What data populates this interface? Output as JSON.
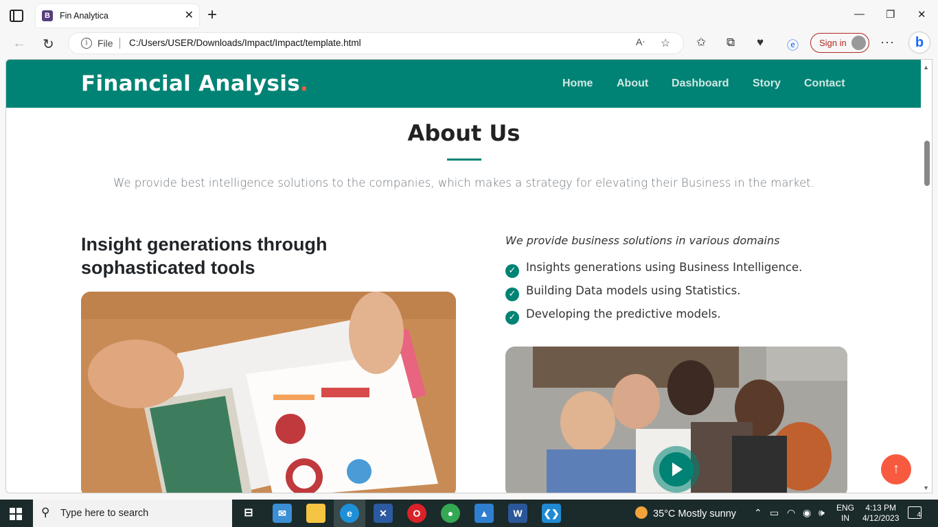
{
  "browser": {
    "tab_title": "Fin Analytica",
    "tab_favicon": "B",
    "address_prefix": "File",
    "url": "C:/Users/USER/Downloads/Impact/Impact/template.html",
    "signin_label": "Sign in"
  },
  "site": {
    "logo_text": "Financial Analysis",
    "logo_dot": ".",
    "nav": [
      "Home",
      "About",
      "Dashboard",
      "Story",
      "Contact"
    ]
  },
  "about": {
    "title": "About Us",
    "description": "We provide best intelligence solutions to the companies, which makes a strategy for elevating their Business in the market.",
    "left_heading": "Insight generations through sophasticated tools",
    "right_intro": "We provide business solutions in various domains",
    "checklist": [
      "Insights generations using Business Intelligence.",
      "Building Data models using Statistics.",
      "Developing the predictive models."
    ]
  },
  "taskbar": {
    "search_placeholder": "Type here to search",
    "weather": "35°C  Mostly sunny",
    "lang_top": "ENG",
    "lang_bottom": "IN",
    "time": "4:13 PM",
    "date": "4/12/2023",
    "notification_count": "4"
  },
  "colors": {
    "brand": "#008374",
    "accent": "#f85a40"
  }
}
